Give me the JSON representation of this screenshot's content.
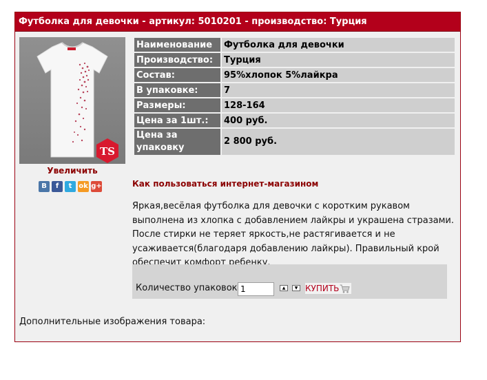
{
  "header": {
    "title": "Футболка для девочки - артикул: 5010201 - производство: Турция"
  },
  "photo": {
    "brand_badge": "TS"
  },
  "enlarge_label": "Увеличить",
  "share": [
    {
      "name": "vkontakte-icon",
      "glyph": "В",
      "color": "#4a76a8"
    },
    {
      "name": "facebook-icon",
      "glyph": "f",
      "color": "#3b5998"
    },
    {
      "name": "twitter-icon",
      "glyph": "t",
      "color": "#2fa9e0"
    },
    {
      "name": "odnoklassniki-icon",
      "glyph": "ok",
      "color": "#f59a23"
    },
    {
      "name": "google-plus-icon",
      "glyph": "g+",
      "color": "#dd4b39"
    }
  ],
  "specs": [
    {
      "label": "Наименование",
      "value": "Футболка для девочки"
    },
    {
      "label": "Производство:",
      "value": "Турция"
    },
    {
      "label": "Состав:",
      "value": "95%хлопок 5%лайкра"
    },
    {
      "label": "В упаковке:",
      "value": "7"
    },
    {
      "label": "Размеры:",
      "value": "128-164"
    },
    {
      "label": "Цена за 1шт.:",
      "value": "400 руб."
    },
    {
      "label": "Цена за упаковку",
      "value": "2 800 руб."
    }
  ],
  "help_link": "Как пользоваться интернет-магазином",
  "description": "Яркая,весёлая футболка для девочки с коротким рукавом выполнена из хлопка с добавлением лайкры и украшена стразами. После стирки не теряет яркость,не растягивается и не усаживается(благодаря добавлению лайкры). Правильный крой обеспечит комфорт ребенку.",
  "order": {
    "qty_label": "Количество упаковок:",
    "qty_value": "1",
    "buy_label": "КУПИТЬ"
  },
  "extra_images_label": "Дополнительные изображения товара:",
  "colors": {
    "header_bg": "#b3001b",
    "accent_text": "#8b0000",
    "spec_label_bg": "#6e6e6e",
    "spec_value_bg": "#cfcfcf",
    "panel_bg": "#f0f0f0"
  }
}
